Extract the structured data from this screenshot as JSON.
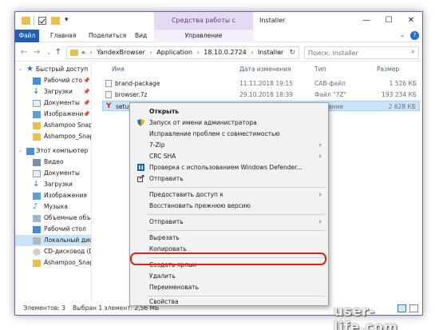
{
  "window": {
    "contextual_tab_title": "Средства работы с приложениями",
    "title": "Installer",
    "controls": {
      "minimize": "—",
      "maximize": "☐",
      "close": "✕"
    }
  },
  "ribbon": {
    "tabs": [
      "Файл",
      "Главная",
      "Поделиться",
      "Вид"
    ],
    "contextual_tab": "Управление",
    "expand": "⌄"
  },
  "address": {
    "prefix": "«",
    "crumbs": [
      "YandexBrowser",
      "Application",
      "18.10.0.2724",
      "Installer"
    ],
    "search_placeholder": "Поиск: Installer"
  },
  "nav": {
    "quick_access": "Быстрый доступ",
    "items": [
      {
        "label": "Рабочий сто",
        "pinned": true
      },
      {
        "label": "Загрузки",
        "pinned": true
      },
      {
        "label": "Документы",
        "pinned": true
      },
      {
        "label": "Изображени",
        "pinned": true
      },
      {
        "label": "Ashampoo Snap",
        "pinned": false
      },
      {
        "label": "Ashampoo_Snap",
        "pinned": false
      }
    ],
    "this_pc": "Этот компьютер",
    "pc_items": [
      "Видео",
      "Документы",
      "Загрузки",
      "Изображения",
      "Музыка",
      "Объемные объе",
      "Рабочий стол",
      "Локальный дис",
      "CD-дисковод (D",
      "Ashampoo_Snap"
    ]
  },
  "columns": {
    "name": "Имя",
    "date": "Дата изменения",
    "type": "Тип",
    "size": "Размер"
  },
  "files": [
    {
      "name": "brand-package",
      "date": "11.11.2018 19:15",
      "type": "CAB-файл",
      "size": "1 526 КБ"
    },
    {
      "name": "browser.7z",
      "date": "29.10.2018 18:39",
      "type": "Файл \"7Z\"",
      "size": "193 234 КБ"
    },
    {
      "name": "setup",
      "date": "",
      "type": "ложение",
      "size": "2 628 КБ"
    }
  ],
  "status": {
    "count": "Элементов: 3",
    "selected": "Выбран 1 элемент: 2,56 МБ"
  },
  "context_menu": {
    "groups": [
      [
        {
          "label": "Открыть",
          "bold": true,
          "icon": "",
          "submenu": false
        },
        {
          "label": "Запуск от имени администратора",
          "bold": false,
          "icon": "shield-icon",
          "submenu": false
        },
        {
          "label": "Исправление проблем с совместимостью",
          "bold": false,
          "icon": "",
          "submenu": false
        },
        {
          "label": "7-Zip",
          "bold": false,
          "icon": "",
          "submenu": true
        },
        {
          "label": "CRC SHA",
          "bold": false,
          "icon": "",
          "submenu": true
        },
        {
          "label": "Проверка с использованием Windows Defender...",
          "bold": false,
          "icon": "defender-icon",
          "submenu": false
        },
        {
          "label": "Отправить",
          "bold": false,
          "icon": "share-icon",
          "submenu": false
        }
      ],
      [
        {
          "label": "Предоставить доступ к",
          "bold": false,
          "icon": "",
          "submenu": true
        },
        {
          "label": "Восстановить прежнюю версию",
          "bold": false,
          "icon": "",
          "submenu": false
        }
      ],
      [
        {
          "label": "Отправить",
          "bold": false,
          "icon": "",
          "submenu": true
        }
      ],
      [
        {
          "label": "Вырезать",
          "bold": false,
          "icon": "",
          "submenu": false
        },
        {
          "label": "Копировать",
          "bold": false,
          "icon": "",
          "submenu": false
        }
      ],
      [
        {
          "label": "Создать ярлык",
          "bold": false,
          "icon": "",
          "submenu": false,
          "highlighted": true
        },
        {
          "label": "Удалить",
          "bold": false,
          "icon": "",
          "submenu": false
        },
        {
          "label": "Переименовать",
          "bold": false,
          "icon": "",
          "submenu": false
        }
      ],
      [
        {
          "label": "Свойства",
          "bold": false,
          "icon": "",
          "submenu": false
        }
      ]
    ],
    "highlight_color": "#d9261c"
  },
  "watermark": "user-life.com",
  "colors": {
    "accent": "#1f5fb5",
    "selection": "#cce4f7",
    "contextual_tab": "#e4daf2"
  }
}
